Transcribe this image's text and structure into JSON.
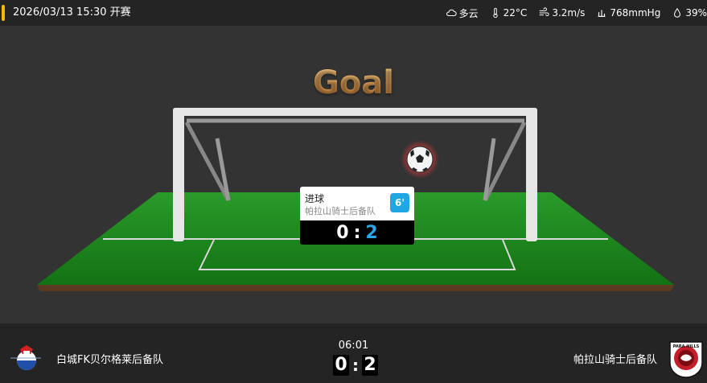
{
  "header": {
    "kickoff": "2026/03/13 15:30 开赛",
    "weather": {
      "condition": "多云",
      "temperature": "22°C",
      "wind": "3.2m/s",
      "pressure": "768mmHg",
      "humidity": "39%"
    },
    "accent_color": "#f5b800"
  },
  "stage": {
    "title": "Goal",
    "event": {
      "type": "进球",
      "team": "帕拉山骑士后备队",
      "minute": "6'",
      "score_home": "0",
      "score_sep": ":",
      "score_away": "2"
    }
  },
  "match": {
    "clock": "06:01",
    "home_team": "白城FK贝尔格莱后备队",
    "away_team": "帕拉山骑士后备队",
    "home_score": "0",
    "score_sep": ":",
    "away_score": "2",
    "away_logo_text": "PARA HILLS · FOOTBALL CLUB"
  },
  "colors": {
    "pitch": "#1f8a1f",
    "minute_badge": "#1ea7e1",
    "away_score": "#2aa6ea"
  }
}
